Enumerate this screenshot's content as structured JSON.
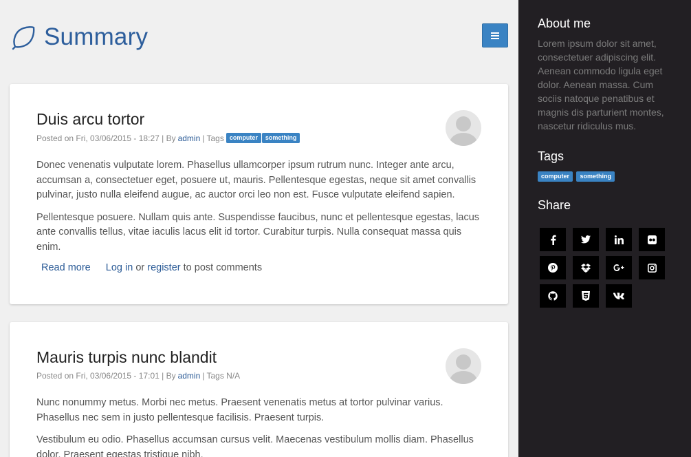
{
  "header": {
    "title": "Summary"
  },
  "posts": [
    {
      "title": "Duis arcu tortor",
      "posted_on": "Posted on Fri, 03/06/2015 - 18:27 | By",
      "author": "admin",
      "tags_label": "| Tags",
      "tags": [
        "computer",
        "something"
      ],
      "paragraphs": [
        "Donec venenatis vulputate lorem. Phasellus ullamcorper ipsum rutrum nunc. Integer ante arcu, accumsan a, consectetuer eget, posuere ut, mauris. Pellentesque egestas, neque sit amet convallis pulvinar, justo nulla eleifend augue, ac auctor orci leo non est. Fusce vulputate eleifend sapien.",
        "Pellentesque posuere. Nullam quis ante. Suspendisse faucibus, nunc et pellentesque egestas, lacus ante convallis tellus, vitae iaculis lacus elit id tortor. Curabitur turpis. Nulla consequat massa quis enim."
      ],
      "read_more": "Read more",
      "login": "Log in",
      "or": "or",
      "register": "register",
      "post_comments": "to post comments"
    },
    {
      "title": "Mauris turpis nunc blandit",
      "posted_on": "Posted on Fri, 03/06/2015 - 17:01 | By",
      "author": "admin",
      "tags_label": "| Tags N/A",
      "paragraphs": [
        "Nunc nonummy metus. Morbi nec metus. Praesent venenatis metus at tortor pulvinar varius. Phasellus nec sem in justo pellentesque facilisis. Praesent turpis.",
        "Vestibulum eu odio. Phasellus accumsan cursus velit. Maecenas vestibulum mollis diam. Phasellus dolor. Praesent egestas tristique nibh."
      ]
    }
  ],
  "sidebar": {
    "about_heading": "About me",
    "about_text": "Lorem ipsum dolor sit amet, consectetuer adipiscing elit. Aenean commodo ligula eget dolor. Aenean massa. Cum sociis natoque penatibus et magnis dis parturient montes, nascetur ridiculus mus.",
    "tags_heading": "Tags",
    "tags": [
      "computer",
      "something"
    ],
    "share_heading": "Share",
    "share_icons": [
      "facebook-icon",
      "twitter-icon",
      "linkedin-icon",
      "flickr-icon",
      "pinterest-icon",
      "dropbox-icon",
      "google-plus-icon",
      "instagram-icon",
      "github-icon",
      "html5-icon",
      "vk-icon"
    ]
  },
  "colors": {
    "accent": "#3a83c3",
    "title": "#2d5e9c",
    "sidebar_bg": "#221f23",
    "page_bg": "#f0f0f0"
  }
}
